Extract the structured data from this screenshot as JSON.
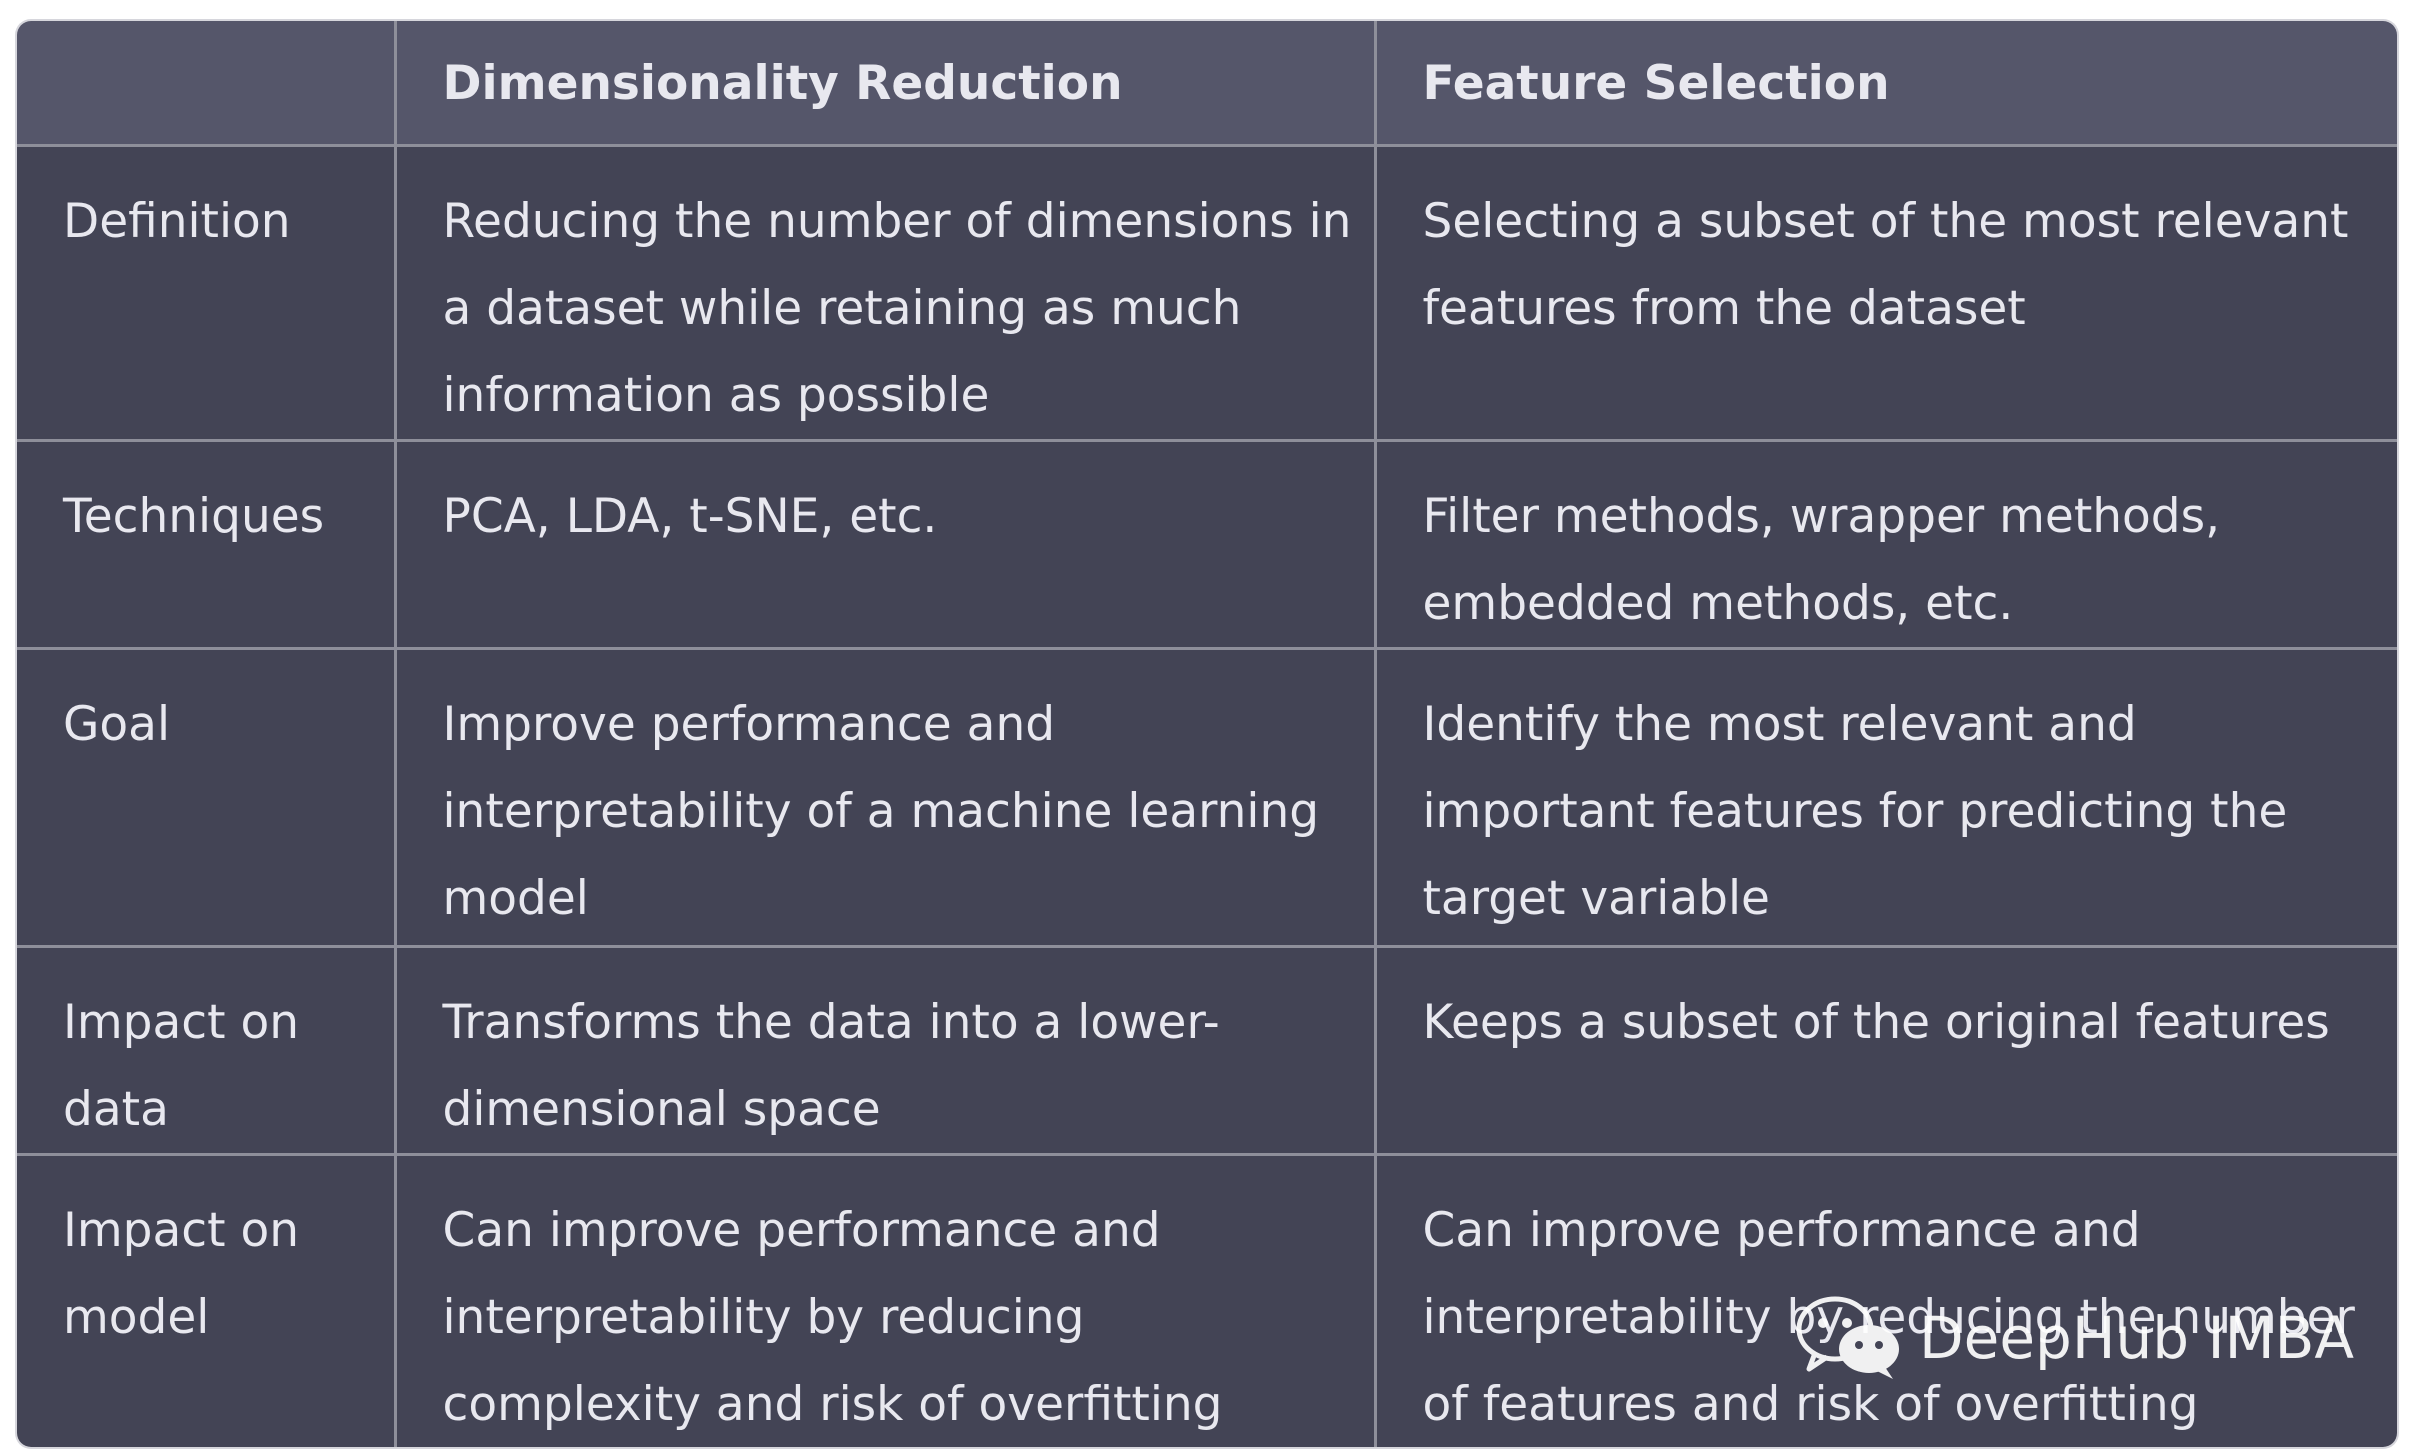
{
  "table": {
    "headers": [
      "",
      "Dimensionality Reduction",
      "Feature Selection"
    ],
    "rows": [
      {
        "label": "Definition",
        "dimensionality_reduction": "Reducing the number of dimensions in a dataset while retaining as much information as possible",
        "feature_selection": "Selecting a subset of the most relevant features from the dataset"
      },
      {
        "label": "Techniques",
        "dimensionality_reduction": "PCA, LDA, t-SNE, etc.",
        "feature_selection": "Filter methods, wrapper methods, embedded methods, etc."
      },
      {
        "label": "Goal",
        "dimensionality_reduction": "Improve performance and interpretability of a machine learning model",
        "feature_selection": "Identify the most relevant and important features for predicting the target variable"
      },
      {
        "label": "Impact on data",
        "dimensionality_reduction": "Transforms the data into a lower-dimensional space",
        "feature_selection": "Keeps a subset of the original features"
      },
      {
        "label": "Impact on model",
        "dimensionality_reduction": "Can improve performance and interpretability by reducing complexity and risk of overfitting",
        "feature_selection": "Can improve performance and interpretability by reducing the number of features and risk of overfitting"
      }
    ]
  },
  "watermark": {
    "icon": "wechat-icon",
    "text": "DeepHub IMBA"
  },
  "colors": {
    "header_bg": "#55566a",
    "cell_bg": "#434455",
    "border": "#8e8f9a",
    "text": "#e8e8ef"
  }
}
